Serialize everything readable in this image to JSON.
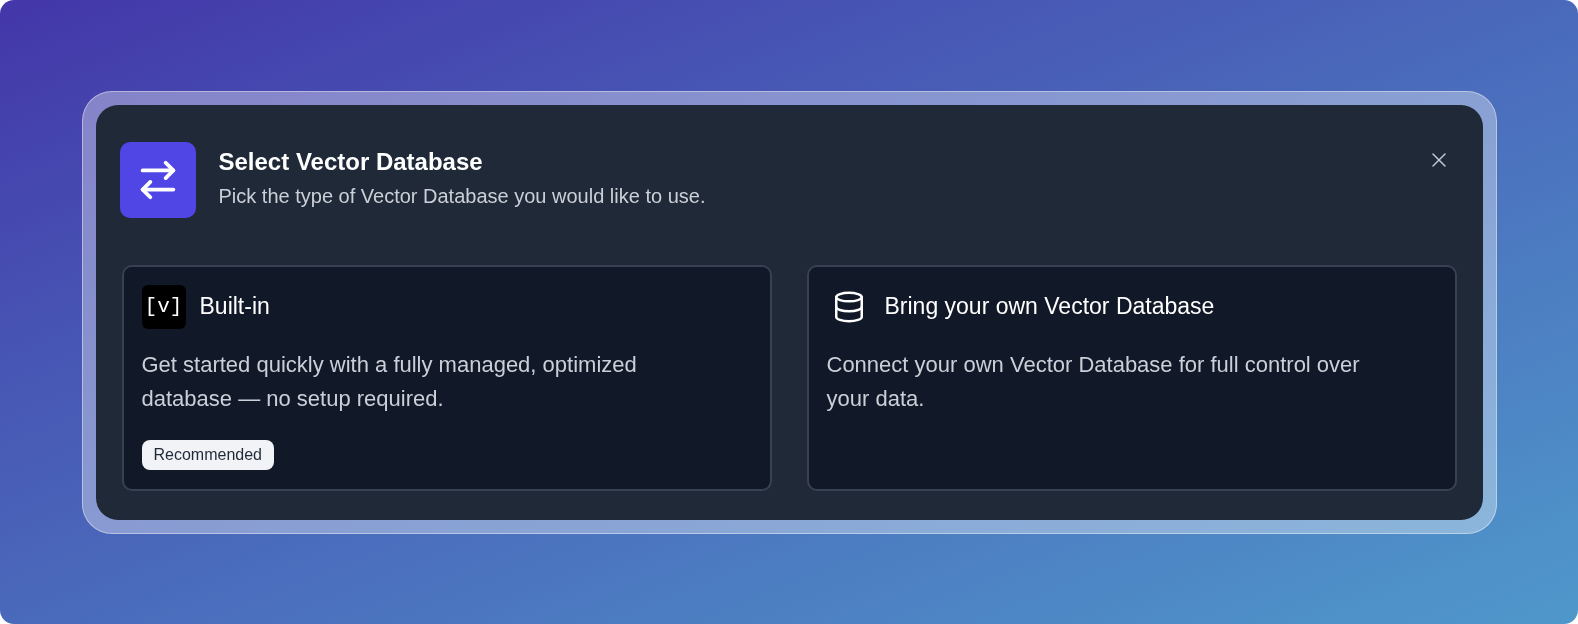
{
  "dialog": {
    "title": "Select Vector Database",
    "subtitle": "Pick the type of Vector Database you would like to use.",
    "options": [
      {
        "kind": "builtin",
        "logo_text": "[v]",
        "title": "Built-in",
        "description": "Get started quickly with a fully managed, optimized database — no setup required.",
        "badge": "Recommended",
        "selected": false
      },
      {
        "kind": "custom",
        "title": "Bring your own Vector Database",
        "description": "Connect your own Vector Database for full control over your data.",
        "selected": false
      }
    ]
  }
}
